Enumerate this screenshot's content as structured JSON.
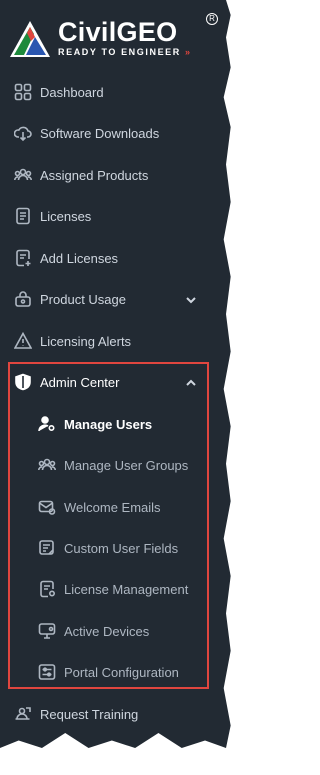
{
  "logo": {
    "brand": "CivilGEO",
    "tagline": "READY TO ENGINEER",
    "arrows": "»",
    "reg": "R"
  },
  "nav": {
    "dashboard": "Dashboard",
    "software_downloads": "Software Downloads",
    "assigned_products": "Assigned Products",
    "licenses": "Licenses",
    "add_licenses": "Add Licenses",
    "product_usage": "Product Usage",
    "licensing_alerts": "Licensing Alerts",
    "admin_center": "Admin Center",
    "request_training": "Request Training"
  },
  "admin_submenu": {
    "manage_users": "Manage Users",
    "manage_user_groups": "Manage User Groups",
    "welcome_emails": "Welcome Emails",
    "custom_user_fields": "Custom User Fields",
    "license_management": "License Management",
    "active_devices": "Active Devices",
    "portal_configuration": "Portal Configuration"
  },
  "colors": {
    "sidebar_bg": "#222a33",
    "highlight": "#e0463f",
    "text": "#cfd6df"
  },
  "icons": [
    "dashboard-icon",
    "cloud-download-icon",
    "users-icon",
    "document-icon",
    "add-document-icon",
    "product-usage-icon",
    "alert-icon",
    "shield-icon",
    "user-gear-icon",
    "users-icon",
    "email-icon",
    "custom-fields-icon",
    "license-icon",
    "device-icon",
    "config-icon",
    "training-icon"
  ]
}
